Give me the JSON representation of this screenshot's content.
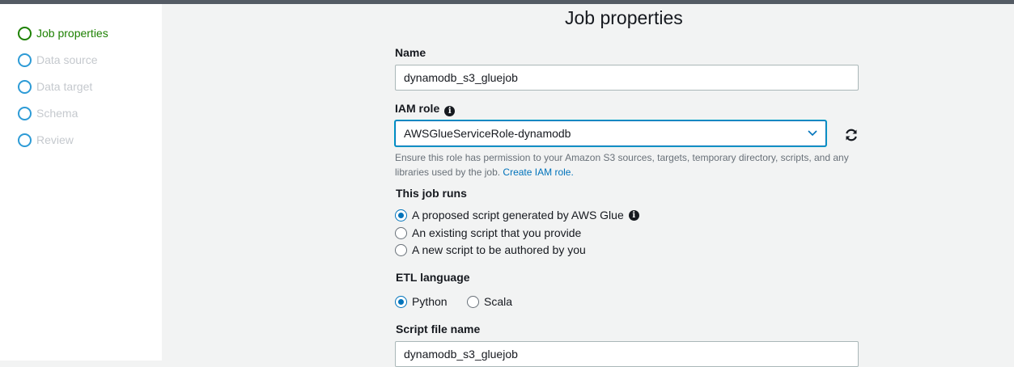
{
  "wizard": {
    "steps": [
      {
        "label": "Job properties",
        "state": "active"
      },
      {
        "label": "Data source",
        "state": "pending"
      },
      {
        "label": "Data target",
        "state": "pending"
      },
      {
        "label": "Schema",
        "state": "pending"
      },
      {
        "label": "Review",
        "state": "pending"
      }
    ]
  },
  "page": {
    "title": "Job properties"
  },
  "form": {
    "name": {
      "label": "Name",
      "value": "dynamodb_s3_gluejob"
    },
    "iam_role": {
      "label": "IAM role",
      "value": "AWSGlueServiceRole-dynamodb",
      "help_text": "Ensure this role has permission to your Amazon S3 sources, targets, temporary directory, scripts, and any libraries used by the job.",
      "help_link": "Create IAM role."
    },
    "job_runs": {
      "label": "This job runs",
      "options": [
        {
          "label": "A proposed script generated by AWS Glue",
          "selected": true
        },
        {
          "label": "An existing script that you provide",
          "selected": false
        },
        {
          "label": "A new script to be authored by you",
          "selected": false
        }
      ]
    },
    "etl_language": {
      "label": "ETL language",
      "options": [
        {
          "label": "Python",
          "selected": true
        },
        {
          "label": "Scala",
          "selected": false
        }
      ]
    },
    "script_file_name": {
      "label": "Script file name",
      "value": "dynamodb_s3_gluejob"
    }
  },
  "colors": {
    "accent": "#0073bb",
    "active_step": "#1d8102",
    "sidebar_bg": "#ffffff",
    "content_bg": "#f2f3f3"
  },
  "icons": {
    "info": "info-icon",
    "refresh": "refresh-icon",
    "dropdown": "chevron-down-icon"
  }
}
